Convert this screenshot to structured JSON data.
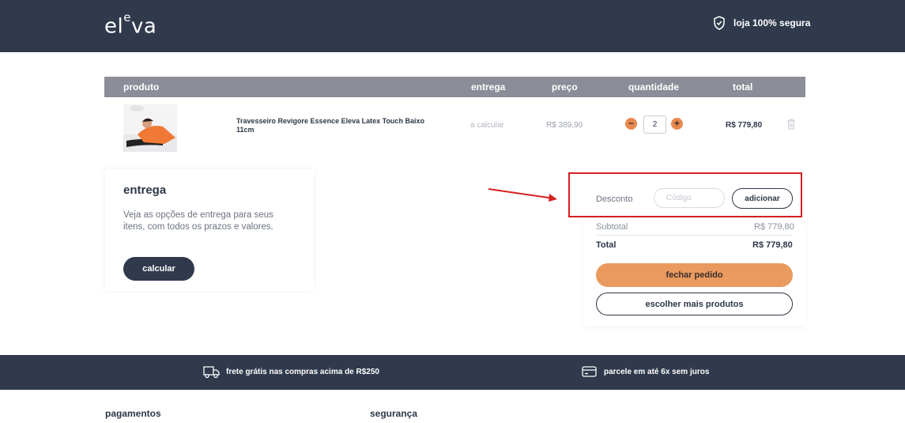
{
  "header": {
    "logo": "eleva",
    "secure_label": "loja 100% segura"
  },
  "table": {
    "columns": {
      "product": "produto",
      "delivery": "entrega",
      "price": "preço",
      "quantity": "quantidade",
      "total": "total"
    },
    "rows": [
      {
        "name": "Travesseiro Revigore Essence Eleva Latex Touch Baixo 11cm",
        "delivery": "a calcular",
        "price": "R$ 389,90",
        "quantity": "2",
        "total": "R$ 779,80"
      }
    ]
  },
  "delivery_card": {
    "title": "entrega",
    "description": "Veja as opções de entrega para seus itens, com todos os prazos e valores.",
    "button": "calcular"
  },
  "summary": {
    "discount_label": "Desconto",
    "code_placeholder": "Código",
    "add_button": "adicionar",
    "subtotal_label": "Subtotal",
    "subtotal_value": "R$ 779,80",
    "total_label": "Total",
    "total_value": "R$ 779,80",
    "checkout_button": "fechar pedido",
    "continue_button": "escolher mais produtos"
  },
  "footer": {
    "free_shipping": "frete grátis nas compras acima de R$250",
    "installments": "parcele em até 6x sem juros",
    "payments_title": "pagamentos",
    "security_title": "segurança"
  },
  "colors": {
    "header_bg": "#303a4c",
    "accent": "#ea9a5f",
    "table_head": "#8b8d98",
    "annotation": "#d62020"
  },
  "icons": [
    "shield-icon",
    "minus-icon",
    "plus-icon",
    "trash-icon",
    "truck-icon",
    "credit-card-icon"
  ]
}
